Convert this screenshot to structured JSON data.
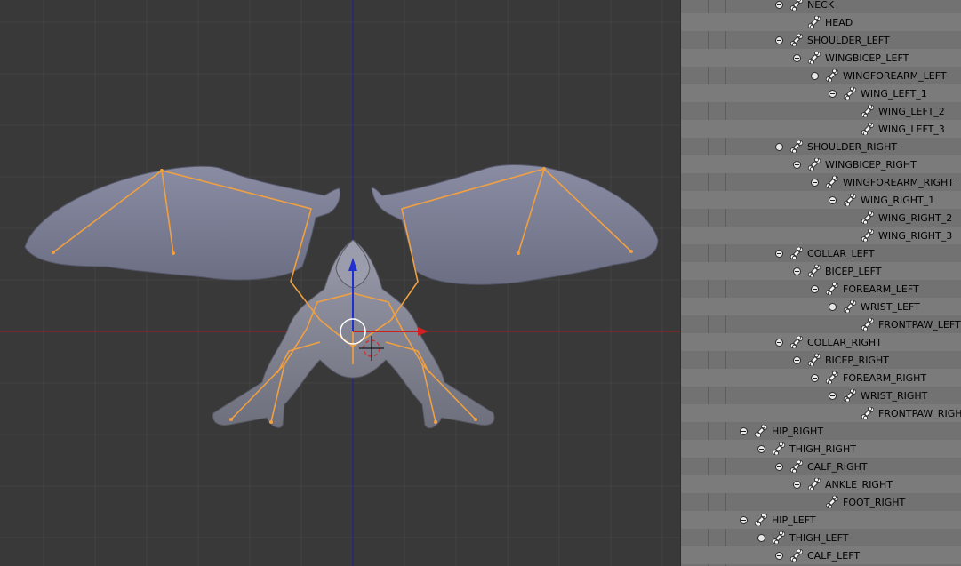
{
  "outliner": {
    "bones": [
      {
        "label": "NECK",
        "depth": 4,
        "expandable": true
      },
      {
        "label": "HEAD",
        "depth": 5,
        "expandable": false
      },
      {
        "label": "SHOULDER_LEFT",
        "depth": 4,
        "expandable": true
      },
      {
        "label": "WINGBICEP_LEFT",
        "depth": 5,
        "expandable": true
      },
      {
        "label": "WINGFOREARM_LEFT",
        "depth": 6,
        "expandable": true
      },
      {
        "label": "WING_LEFT_1",
        "depth": 7,
        "expandable": true
      },
      {
        "label": "WING_LEFT_2",
        "depth": 8,
        "expandable": false
      },
      {
        "label": "WING_LEFT_3",
        "depth": 8,
        "expandable": false
      },
      {
        "label": "SHOULDER_RIGHT",
        "depth": 4,
        "expandable": true
      },
      {
        "label": "WINGBICEP_RIGHT",
        "depth": 5,
        "expandable": true
      },
      {
        "label": "WINGFOREARM_RIGHT",
        "depth": 6,
        "expandable": true
      },
      {
        "label": "WING_RIGHT_1",
        "depth": 7,
        "expandable": true
      },
      {
        "label": "WING_RIGHT_2",
        "depth": 8,
        "expandable": false
      },
      {
        "label": "WING_RIGHT_3",
        "depth": 8,
        "expandable": false
      },
      {
        "label": "COLLAR_LEFT",
        "depth": 4,
        "expandable": true
      },
      {
        "label": "BICEP_LEFT",
        "depth": 5,
        "expandable": true
      },
      {
        "label": "FOREARM_LEFT",
        "depth": 6,
        "expandable": true
      },
      {
        "label": "WRIST_LEFT",
        "depth": 7,
        "expandable": true
      },
      {
        "label": "FRONTPAW_LEFT",
        "depth": 8,
        "expandable": false
      },
      {
        "label": "COLLAR_RIGHT",
        "depth": 4,
        "expandable": true
      },
      {
        "label": "BICEP_RIGHT",
        "depth": 5,
        "expandable": true
      },
      {
        "label": "FOREARM_RIGHT",
        "depth": 6,
        "expandable": true
      },
      {
        "label": "WRIST_RIGHT",
        "depth": 7,
        "expandable": true
      },
      {
        "label": "FRONTPAW_RIGHT",
        "depth": 8,
        "expandable": false
      },
      {
        "label": "HIP_RIGHT",
        "depth": 2,
        "expandable": true
      },
      {
        "label": "THIGH_RIGHT",
        "depth": 3,
        "expandable": true
      },
      {
        "label": "CALF_RIGHT",
        "depth": 4,
        "expandable": true
      },
      {
        "label": "ANKLE_RIGHT",
        "depth": 5,
        "expandable": true
      },
      {
        "label": "FOOT_RIGHT",
        "depth": 6,
        "expandable": false
      },
      {
        "label": "HIP_LEFT",
        "depth": 2,
        "expandable": true
      },
      {
        "label": "THIGH_LEFT",
        "depth": 3,
        "expandable": true
      },
      {
        "label": "CALF_LEFT",
        "depth": 4,
        "expandable": true
      }
    ]
  },
  "icons": {
    "expand_toggle": "minus-circle-icon",
    "bone": "bone-icon"
  },
  "colors": {
    "viewport_bg": "#393939",
    "grid_line": "#444444",
    "x_axis": "#a02020",
    "z_axis": "#2020a0",
    "bone_wire": "#f0a040",
    "mesh": "#8c8d9b",
    "outliner_bg": "#727272",
    "outliner_row_alt": "#7b7b7b"
  }
}
